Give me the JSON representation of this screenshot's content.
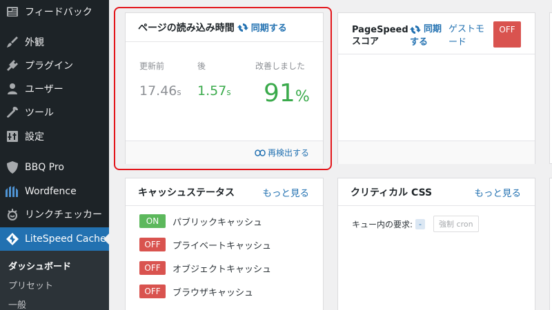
{
  "sidebar": {
    "items": [
      {
        "label": "フィードバック",
        "icon": "feedback-icon"
      },
      {
        "label": "外観",
        "icon": "paintbrush-icon"
      },
      {
        "label": "プラグイン",
        "icon": "plugin-icon"
      },
      {
        "label": "ユーザー",
        "icon": "user-icon"
      },
      {
        "label": "ツール",
        "icon": "wrench-icon"
      },
      {
        "label": "設定",
        "icon": "settings-icon"
      },
      {
        "label": "BBQ Pro",
        "icon": "shield-icon"
      },
      {
        "label": "Wordfence",
        "icon": "wordfence-icon"
      },
      {
        "label": "リンクチェッカー",
        "icon": "link-checker-icon"
      },
      {
        "label": "LiteSpeed Cache",
        "icon": "litespeed-icon"
      }
    ],
    "submenu": [
      "ダッシュボード",
      "プリセット",
      "一般"
    ]
  },
  "load_time": {
    "title": "ページの読み込み時間",
    "sync": "同期する",
    "before_label": "更新前",
    "before_value": "17.46",
    "before_unit": "s",
    "after_label": "後",
    "after_value": "1.57",
    "after_unit": "s",
    "improved_label": "改善しました",
    "improved_value": "91",
    "improved_unit": "%",
    "redetect": "再検出する"
  },
  "pagespeed": {
    "title_line1": "PageSpeed",
    "title_line2": "スコア",
    "sync_line1": "同期",
    "sync_line2": "する",
    "guest_line1": "ゲストモ",
    "guest_line2": "ード",
    "toggle": "OFF"
  },
  "cache_status": {
    "title": "キャッシュステータス",
    "more": "もっと見る",
    "rows": [
      {
        "state": "ON",
        "label": "パブリックキャッシュ"
      },
      {
        "state": "OFF",
        "label": "プライベートキャッシュ"
      },
      {
        "state": "OFF",
        "label": "オブジェクトキャッシュ"
      },
      {
        "state": "OFF",
        "label": "ブラウザキャッシュ"
      }
    ]
  },
  "critical_css": {
    "title": "クリティカル CSS",
    "more": "もっと見る",
    "queue_label": "キュー内の要求:",
    "queue_value": "-",
    "force_cron": "強制 cron"
  },
  "colors": {
    "sidebar_bg": "#1d2327",
    "active_bg": "#2271b1",
    "link": "#2271b1",
    "success": "#3aaa4b",
    "danger": "#d9534f",
    "highlight": "#e3151a"
  }
}
